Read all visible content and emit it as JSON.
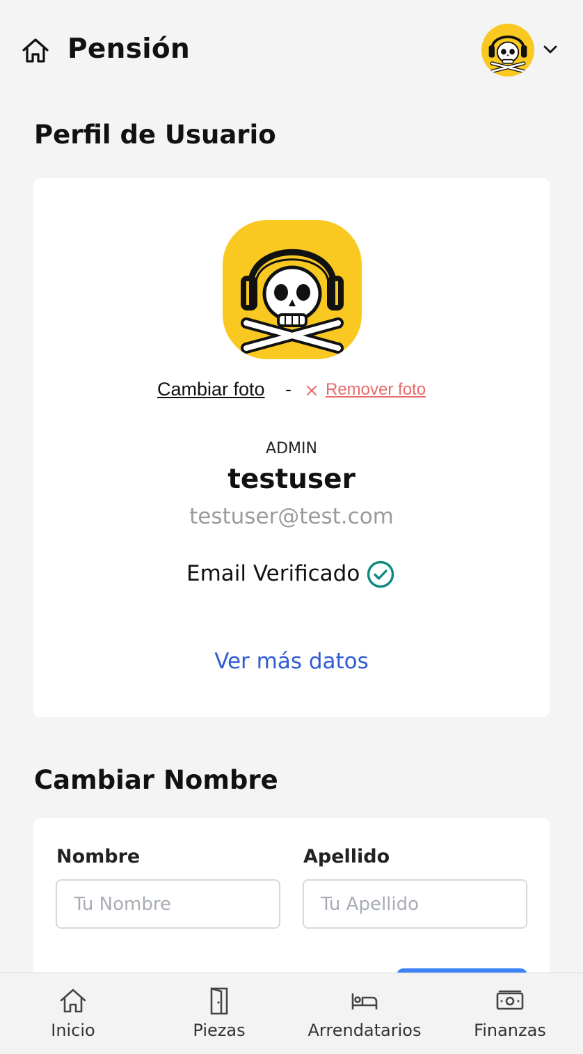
{
  "header": {
    "title": "Pensión",
    "home_icon": "home-icon",
    "avatar_icon": "skull-headphones-avatar",
    "menu_icon": "chevron-down-icon"
  },
  "profile": {
    "section_title": "Perfil de Usuario",
    "change_photo": "Cambiar foto",
    "separator": "-",
    "remove_photo": "Remover foto",
    "role": "ADMIN",
    "username": "testuser",
    "email": "testuser@test.com",
    "email_status": "Email Verificado",
    "more_data": "Ver más datos"
  },
  "change_name": {
    "section_title": "Cambiar Nombre",
    "first_name_label": "Nombre",
    "first_name_placeholder": "Tu Nombre",
    "first_name_value": "",
    "last_name_label": "Apellido",
    "last_name_placeholder": "Tu Apellido",
    "last_name_value": ""
  },
  "nav": {
    "items": [
      {
        "label": "Inicio",
        "icon": "home-icon"
      },
      {
        "label": "Piezas",
        "icon": "door-icon"
      },
      {
        "label": "Arrendatarios",
        "icon": "bed-icon"
      },
      {
        "label": "Finanzas",
        "icon": "money-icon"
      }
    ]
  },
  "colors": {
    "background": "#f4f4f4",
    "avatar_bg": "#f9c922",
    "link_blue": "#2f5bd4",
    "remove_red": "#e86a6a",
    "verified_teal": "#0d8a80",
    "button_blue": "#3b82f6"
  }
}
